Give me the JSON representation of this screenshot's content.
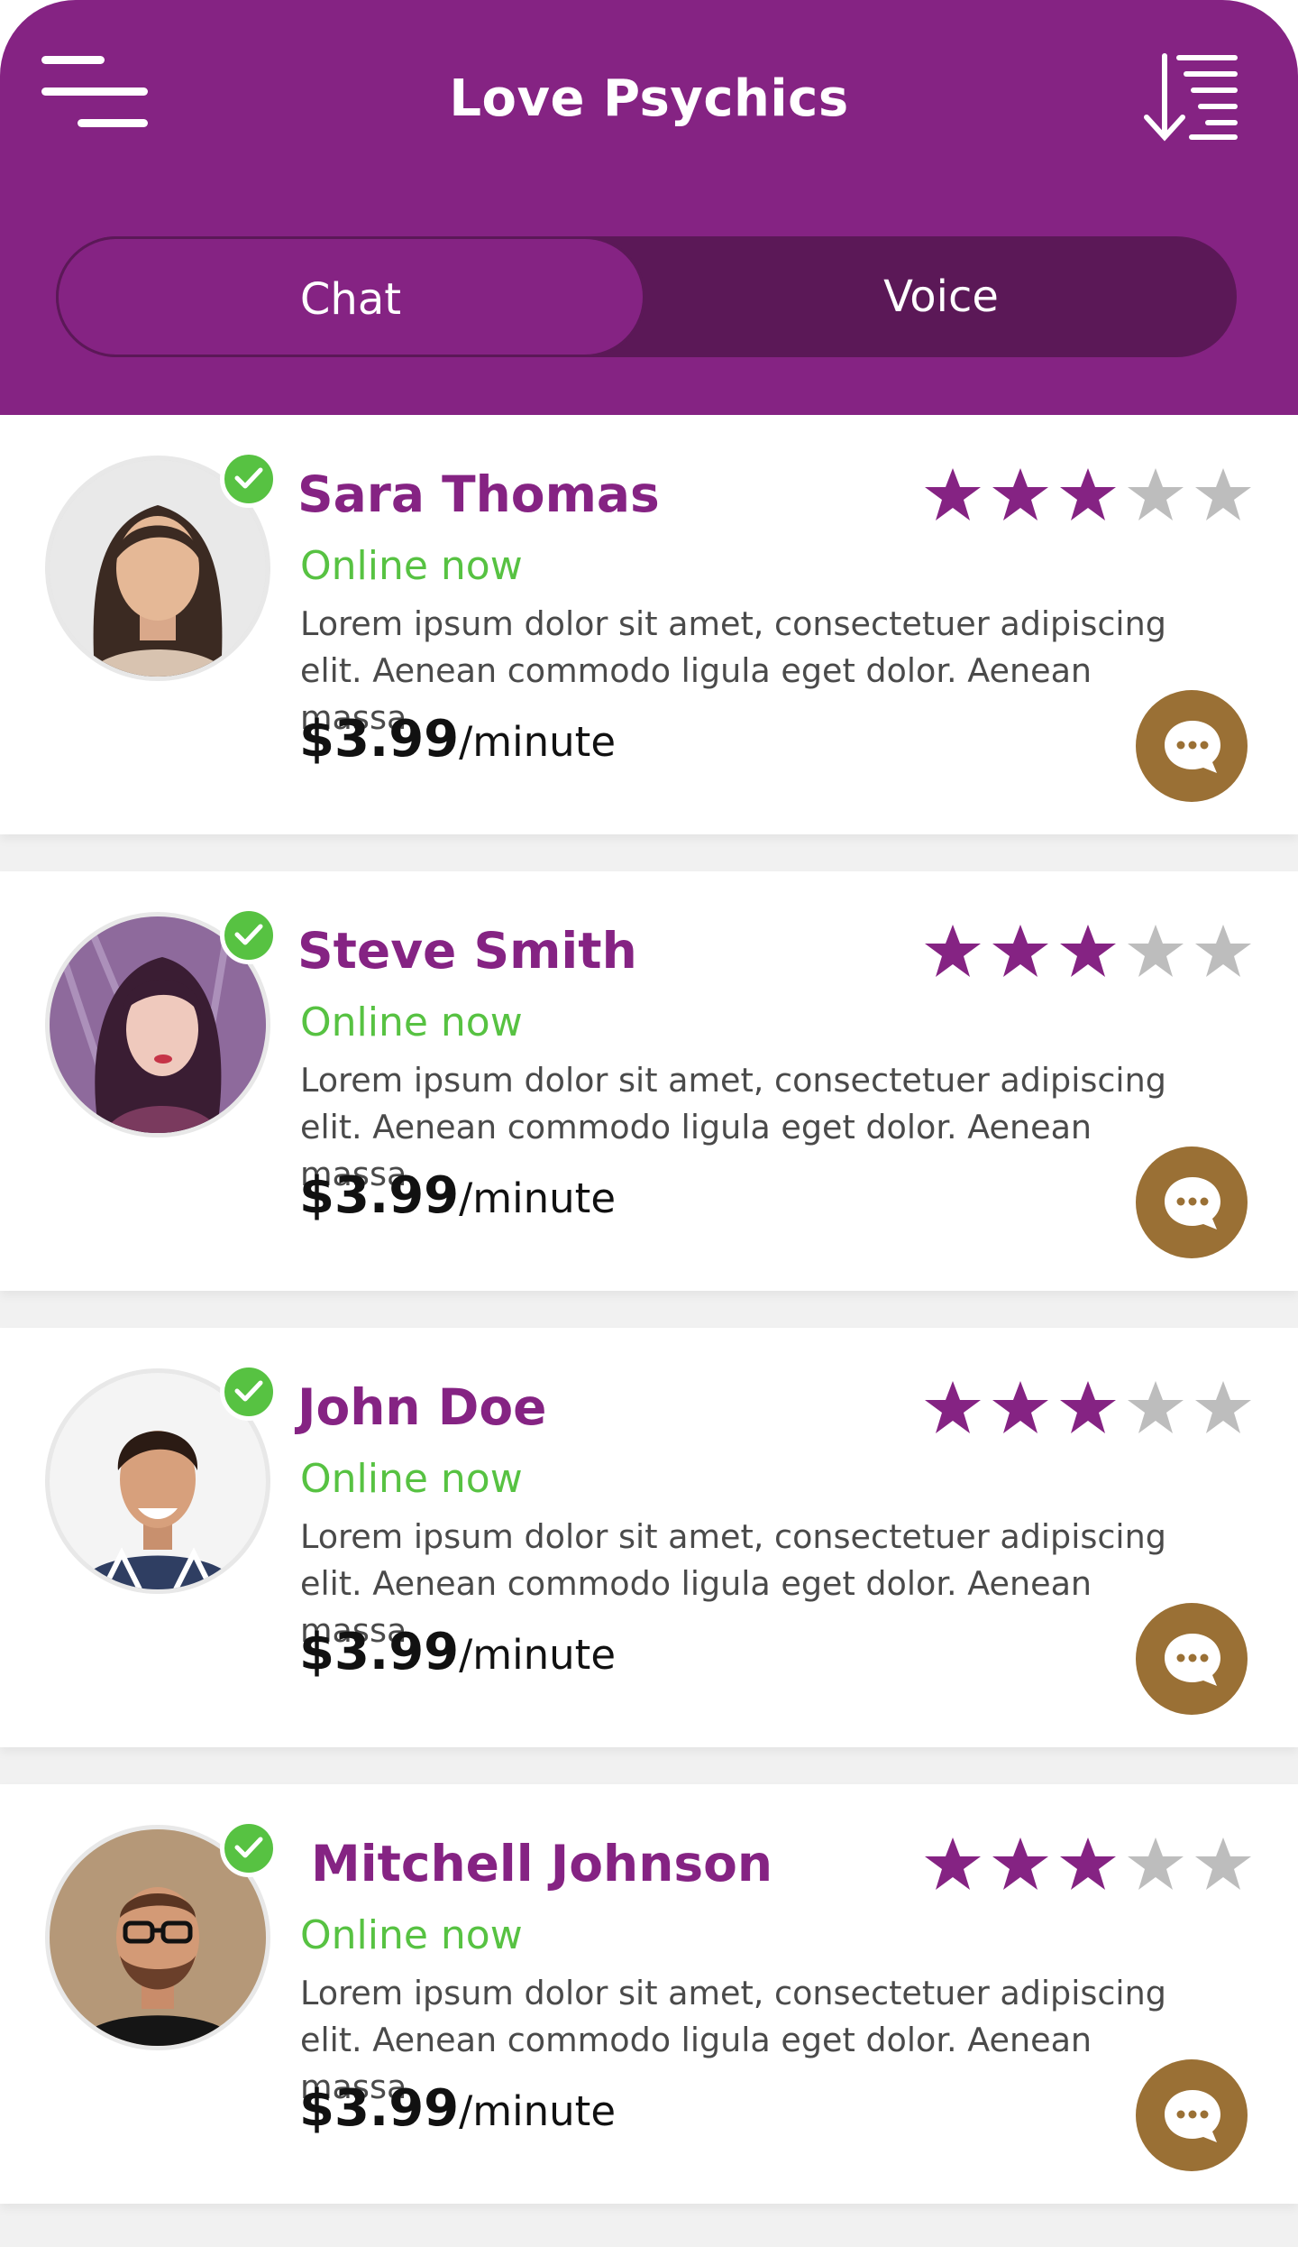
{
  "header": {
    "title": "Love Psychics",
    "menu_icon": "hamburger-menu-icon",
    "sort_icon": "sort-descending-icon"
  },
  "tabs": [
    {
      "label": "Chat",
      "active": true
    },
    {
      "label": "Voice",
      "active": false
    }
  ],
  "colors": {
    "brand_purple": "#852383",
    "tab_dark": "#5b1857",
    "online_green": "#57c242",
    "chat_button_gold": "#9a7035",
    "star_empty": "#bdbdbd"
  },
  "psychics": [
    {
      "name": "Sara Thomas",
      "status": "Online now",
      "description": "Lorem ipsum dolor sit amet, consectetuer adipiscing elit. Aenean commodo ligula eget dolor. Aenean massa.",
      "price": "$3.99",
      "unit": "/minute",
      "rating": 3,
      "rating_max": 5,
      "verified": true
    },
    {
      "name": "Steve Smith",
      "status": "Online now",
      "description": "Lorem ipsum dolor sit amet, consectetuer adipiscing elit. Aenean commodo ligula eget dolor. Aenean massa.",
      "price": "$3.99",
      "unit": "/minute",
      "rating": 3,
      "rating_max": 5,
      "verified": true
    },
    {
      "name": "John Doe",
      "status": "Online now",
      "description": "Lorem ipsum dolor sit amet, consectetuer adipiscing elit. Aenean commodo ligula eget dolor. Aenean massa.",
      "price": "$3.99",
      "unit": "/minute",
      "rating": 3,
      "rating_max": 5,
      "verified": true
    },
    {
      "name": "Mitchell Johnson",
      "status": "Online now",
      "description": "Lorem ipsum dolor sit amet, consectetuer adipiscing elit. Aenean commodo ligula eget dolor. Aenean massa.",
      "price": "$3.99",
      "unit": "/minute",
      "rating": 3,
      "rating_max": 5,
      "verified": true
    }
  ]
}
